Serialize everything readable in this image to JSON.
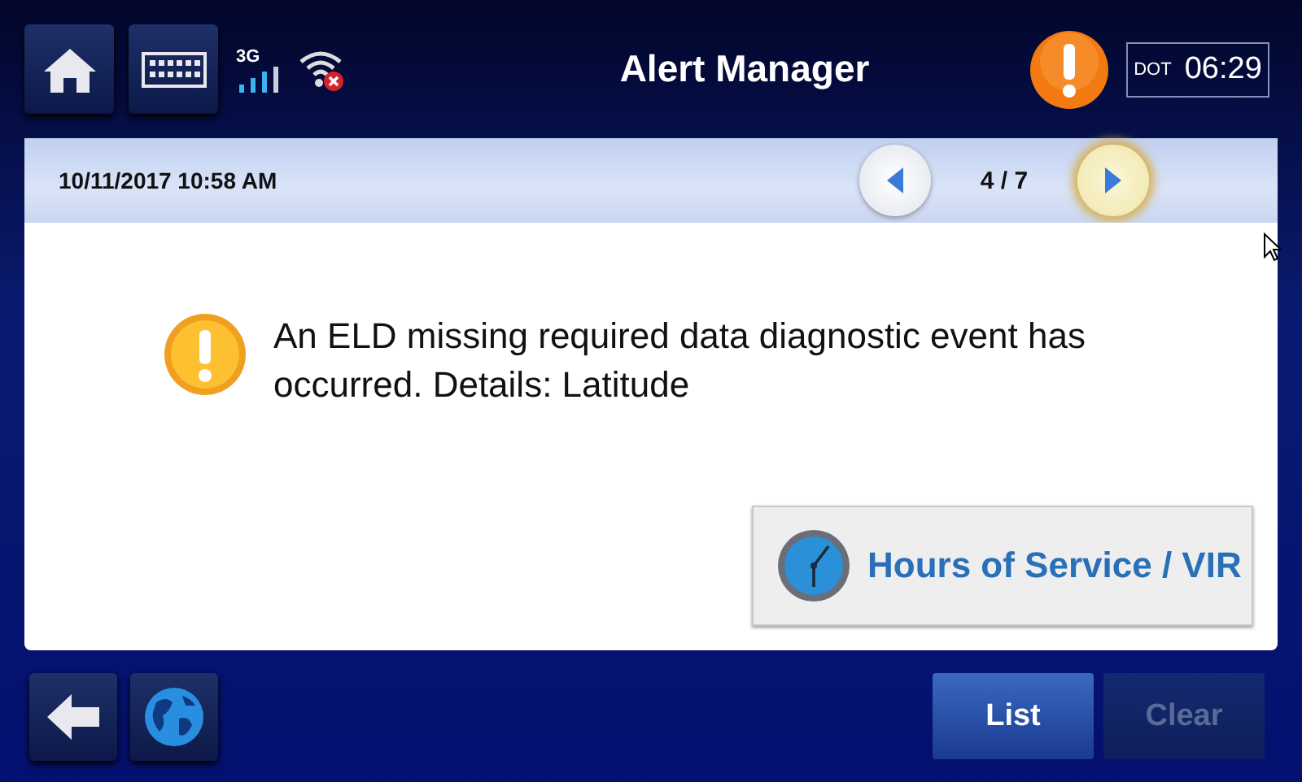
{
  "header": {
    "title": "Alert Manager",
    "network": "3G",
    "clock": {
      "label": "DOT",
      "time": "06:29"
    }
  },
  "alert": {
    "timestamp": "10/11/2017 10:58 AM",
    "position": "4 / 7",
    "message": "An ELD missing required data diagnostic event has occurred. Details: Latitude",
    "action": "Hours of Service / VIR"
  },
  "footer": {
    "buttons": [
      {
        "label": "List",
        "disabled": false
      },
      {
        "label": "Clear",
        "disabled": true
      }
    ]
  }
}
